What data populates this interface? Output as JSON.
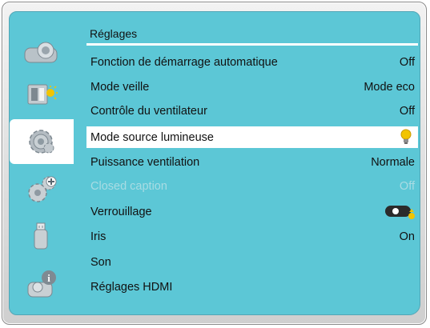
{
  "menu": {
    "title": "Réglages",
    "rows": [
      {
        "label": "Fonction de démarrage automatique",
        "value": "Off"
      },
      {
        "label": "Mode veille",
        "value": "Mode eco"
      },
      {
        "label": "Contrôle du ventilateur",
        "value": "Off"
      },
      {
        "label": "Mode source lumineuse",
        "value_icon": "lightbulb-icon",
        "selected": true
      },
      {
        "label": "Puissance ventilation",
        "value": "Normale"
      },
      {
        "label": "Closed caption",
        "value": "Off",
        "disabled": true
      },
      {
        "label": "Verrouillage",
        "value_icon": "lock-toggle-icon"
      },
      {
        "label": "Iris",
        "value": "On"
      },
      {
        "label": "Son",
        "value": ""
      },
      {
        "label": "Réglages HDMI",
        "value": ""
      }
    ]
  },
  "sidebar": {
    "items": [
      {
        "icon": "projector-icon"
      },
      {
        "icon": "image-adjust-icon"
      },
      {
        "icon": "settings-gear-icon",
        "selected": true
      },
      {
        "icon": "advanced-gears-icon"
      },
      {
        "icon": "usb-icon"
      },
      {
        "icon": "info-icon"
      }
    ]
  },
  "colors": {
    "panel": "#5cc7d6",
    "selected_row": "#ffffff",
    "disabled_text": "#a9dce3",
    "bulb": "#f2c400"
  }
}
